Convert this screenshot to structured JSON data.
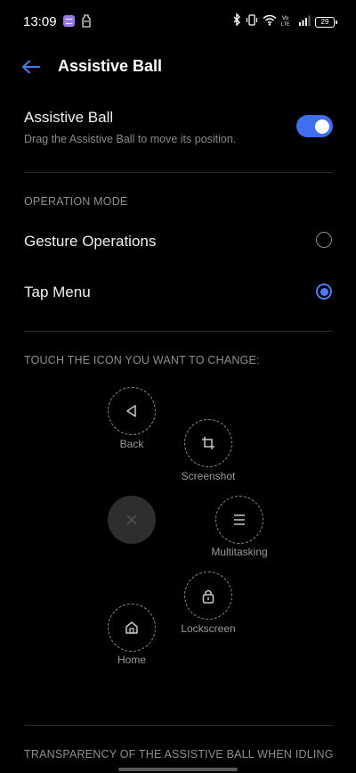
{
  "status": {
    "time": "13:09",
    "battery": "29"
  },
  "header": {
    "title": "Assistive Ball"
  },
  "assistive": {
    "title": "Assistive Ball",
    "subtitle": "Drag the Assistive Ball to move its position.",
    "enabled": true
  },
  "operation_mode": {
    "label": "OPERATION MODE",
    "options": [
      {
        "label": "Gesture Operations",
        "selected": false
      },
      {
        "label": "Tap Menu",
        "selected": true
      }
    ]
  },
  "icons_section": {
    "label": "TOUCH THE ICON YOU WANT TO CHANGE:",
    "items": [
      {
        "label": "Back",
        "icon": "back-triangle-icon"
      },
      {
        "label": "Screenshot",
        "icon": "crop-icon"
      },
      {
        "label": "Multitasking",
        "icon": "menu-lines-icon"
      },
      {
        "label": "Lockscreen",
        "icon": "lock-icon"
      },
      {
        "label": "Home",
        "icon": "home-icon"
      }
    ],
    "center_icon": "close-icon"
  },
  "transparency": {
    "label": "TRANSPARENCY OF THE ASSISTIVE BALL WHEN IDLING"
  },
  "colors": {
    "accent": "#3d6ff0",
    "background": "#000000"
  }
}
